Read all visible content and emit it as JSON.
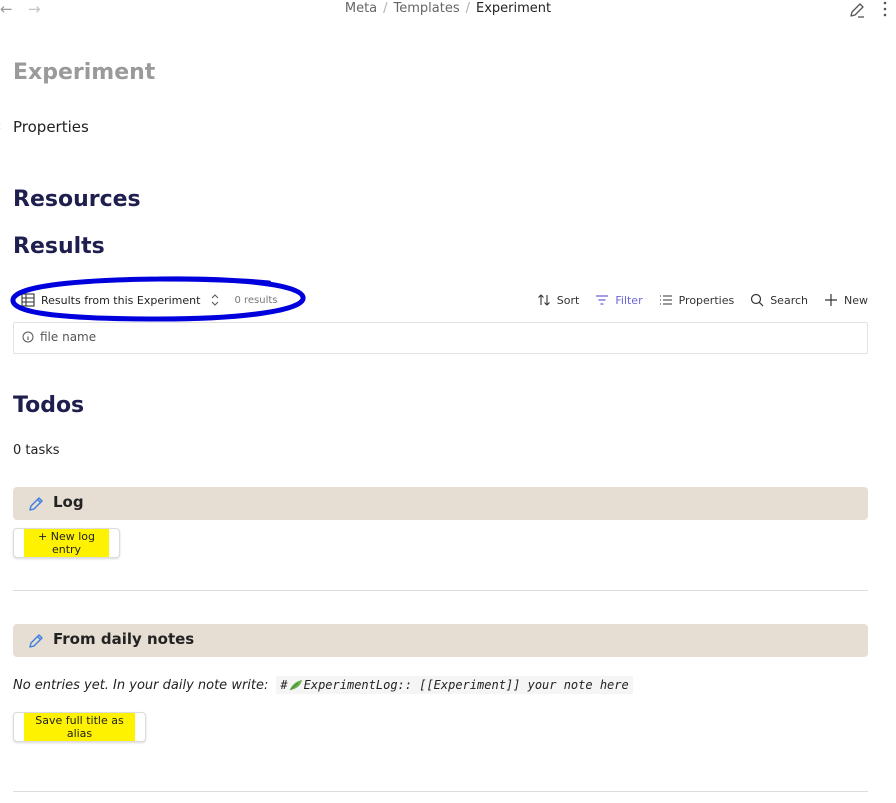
{
  "breadcrumb": {
    "items": [
      "Meta",
      "Templates"
    ],
    "current": "Experiment",
    "separator": "/"
  },
  "page": {
    "title": "Experiment",
    "properties_label": "Properties"
  },
  "headings": {
    "resources": "Resources",
    "results": "Results",
    "todos": "Todos"
  },
  "base": {
    "view_name": "Results from this Experiment",
    "results_count": "0 results",
    "actions": {
      "sort": "Sort",
      "filter": "Filter",
      "properties": "Properties",
      "search": "Search",
      "new": "New"
    },
    "columns": [
      "file name"
    ]
  },
  "todos": {
    "count_text": "0 tasks"
  },
  "log": {
    "callout_title": "Log",
    "button_label": "+ New log entry"
  },
  "daily": {
    "callout_title": "From daily notes",
    "empty_text": "No entries yet. In your daily note write:",
    "code_prefix": "#",
    "code_text": "ExperimentLog:: [[Experiment]] your note here",
    "button_label": "Save full title as alias"
  },
  "colors": {
    "heading": "#1f1f4f",
    "accent": "#6b63d8",
    "callout_bg": "#e6ddd3",
    "highlight": "#fff200",
    "annotation_ring": "#0000dd"
  },
  "icons": [
    "arrow-left-icon",
    "arrow-right-icon",
    "edit-icon",
    "more-vertical-icon",
    "table-icon",
    "sort-icon",
    "filter-icon",
    "list-icon",
    "search-icon",
    "plus-icon",
    "info-icon",
    "pencil-icon",
    "leaf-emoji-icon"
  ]
}
